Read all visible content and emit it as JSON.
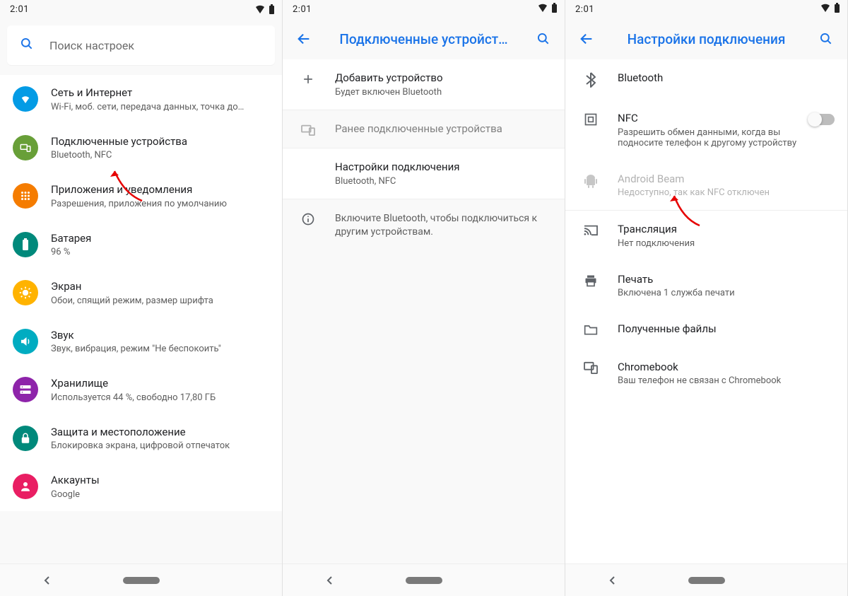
{
  "statusBar": {
    "time": "2:01"
  },
  "screen1": {
    "searchPlaceholder": "Поиск настроек",
    "items": [
      {
        "title": "Сеть и Интернет",
        "sub": "Wi-Fi, моб. сети, передача данных, точка до…",
        "color": "#039be5",
        "icon": "wifi"
      },
      {
        "title": "Подключенные устройства",
        "sub": "Bluetooth, NFC",
        "color": "#689f38",
        "icon": "devices"
      },
      {
        "title": "Приложения и уведомления",
        "sub": "Разрешения, приложения по умолчанию",
        "color": "#f57c00",
        "icon": "apps"
      },
      {
        "title": "Батарея",
        "sub": "96 %",
        "color": "#00897b",
        "icon": "battery"
      },
      {
        "title": "Экран",
        "sub": "Обои, спящий режим, размер шрифта",
        "color": "#ffb300",
        "icon": "display"
      },
      {
        "title": "Звук",
        "sub": "Звук, вибрация, режим \"Не беспокоить\"",
        "color": "#00acc1",
        "icon": "sound"
      },
      {
        "title": "Хранилище",
        "sub": "Используется 44 %, свободно 17,80 ГБ",
        "color": "#8e24aa",
        "icon": "storage"
      },
      {
        "title": "Защита и местоположение",
        "sub": "Блокировка экрана, цифровой отпечаток",
        "color": "#00897b",
        "icon": "security"
      },
      {
        "title": "Аккаунты",
        "sub": "Google",
        "color": "#e91e63",
        "icon": "accounts"
      }
    ]
  },
  "screen2": {
    "title": "Подключенные устройст…",
    "addDevice": {
      "title": "Добавить устройство",
      "sub": "Будет включен Bluetooth"
    },
    "prevConnected": "Ранее подключенные устройства",
    "connPrefs": {
      "title": "Настройки подключения",
      "sub": "Bluetooth, NFC"
    },
    "infoText": "Включите Bluetooth, чтобы подключиться к другим устройствам."
  },
  "screen3": {
    "title": "Настройки подключения",
    "items": {
      "bluetooth": {
        "title": "Bluetooth"
      },
      "nfc": {
        "title": "NFC",
        "sub": "Разрешить обмен данными, когда вы подносите телефон к другому устройству"
      },
      "beam": {
        "title": "Android Beam",
        "sub": "Недоступно, так как NFC отключен"
      },
      "cast": {
        "title": "Трансляция",
        "sub": "Нет подключения"
      },
      "print": {
        "title": "Печать",
        "sub": "Включена 1 служба печати"
      },
      "files": {
        "title": "Полученные файлы"
      },
      "chromebook": {
        "title": "Chromebook",
        "sub": "Ваш телефон не связан с Chromebook"
      }
    }
  }
}
